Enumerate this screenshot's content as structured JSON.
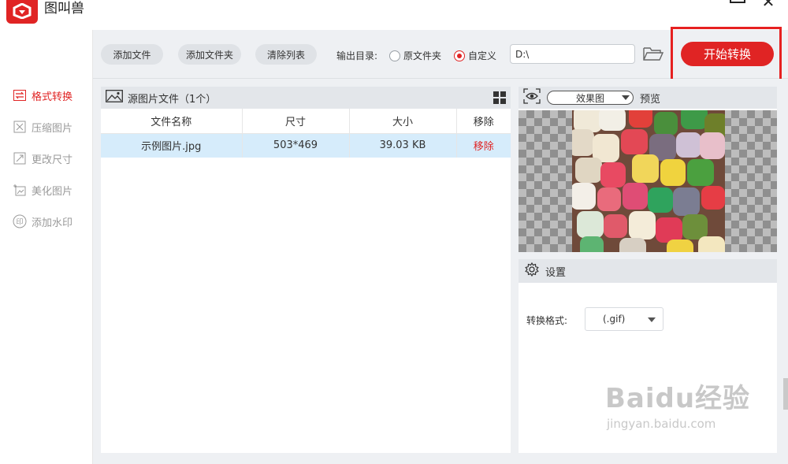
{
  "app": {
    "title": "图叫兽"
  },
  "sidebar": {
    "items": [
      {
        "label": "格式转换",
        "icon": "convert-icon",
        "active": true
      },
      {
        "label": "压缩图片",
        "icon": "compress-icon",
        "active": false
      },
      {
        "label": "更改尺寸",
        "icon": "resize-icon",
        "active": false
      },
      {
        "label": "美化图片",
        "icon": "beautify-icon",
        "active": false
      },
      {
        "label": "添加水印",
        "icon": "watermark-icon",
        "active": false
      }
    ]
  },
  "toolbar": {
    "add_file": "添加文件",
    "add_folder": "添加文件夹",
    "clear_list": "清除列表",
    "output_label": "输出目录:",
    "radio_original": "原文件夹",
    "radio_custom": "自定义",
    "selected_output": "自定义",
    "path_value": "D:\\",
    "start": "开始转换"
  },
  "file_panel": {
    "title": "源图片文件（1个）",
    "columns": [
      "文件名称",
      "尺寸",
      "大小",
      "移除"
    ],
    "rows": [
      {
        "name": "示例图片.jpg",
        "size": "503*469",
        "filesize": "39.03 KB",
        "action": "移除"
      }
    ]
  },
  "preview": {
    "mode": "效果图",
    "label": "预览"
  },
  "settings": {
    "title": "设置",
    "format_label": "转换格式:",
    "format_value": "(.gif)"
  },
  "watermark": {
    "main": "Baidu经验",
    "sub": "jingyan.baidu.com"
  },
  "colors": {
    "accent": "#e02424",
    "selected_row": "#d6ecfb",
    "toolbar_bg": "#eef0f3"
  }
}
